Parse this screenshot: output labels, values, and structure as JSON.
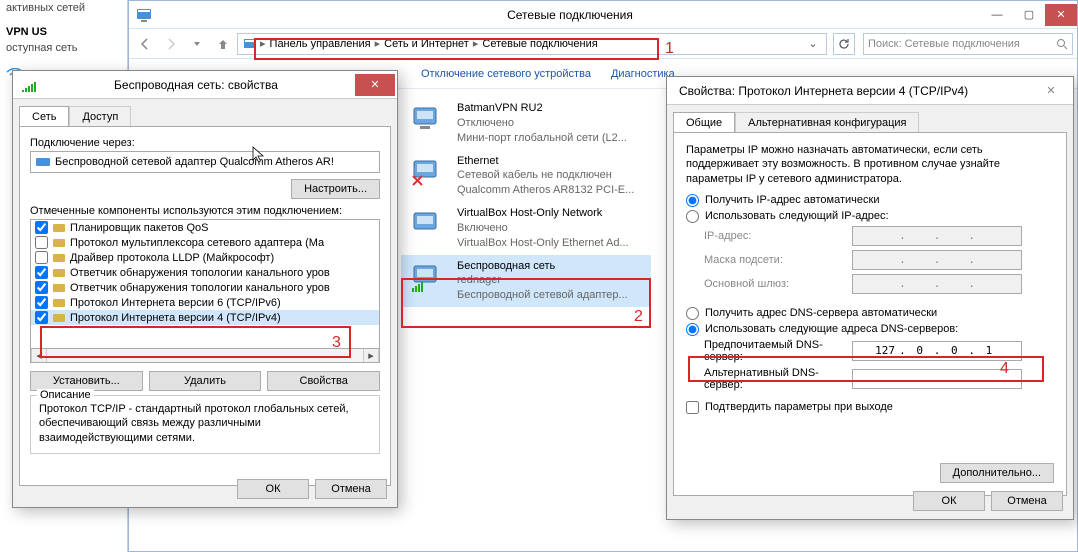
{
  "leftpanel": {
    "row1": "активных сетей",
    "vpn": "VPN US",
    "sub": "оступная сеть"
  },
  "explorer": {
    "title": "Сетевые подключения",
    "breadcrumbs": [
      "Панель управления",
      "Сеть и Интернет",
      "Сетевые подключения"
    ],
    "search_placeholder": "Поиск: Сетевые подключения",
    "toolbar": {
      "disable": "Отключение сетевого устройства",
      "diag": "Диагностика"
    },
    "items": [
      {
        "name": "BatmanVPN RU2",
        "status": "Отключено",
        "desc": "Мини-порт глобальной сети (L2..."
      },
      {
        "name": "Ethernet",
        "status": "Сетевой кабель не подключен",
        "desc": "Qualcomm Atheros AR8132 PCI-E..."
      },
      {
        "name": "VirtualBox Host-Only Network",
        "status": "Включено",
        "desc": "VirtualBox Host-Only Ethernet Ad..."
      },
      {
        "name": "Беспроводная сеть",
        "status": "rednager",
        "desc": "Беспроводной сетевой адаптер..."
      }
    ]
  },
  "dlg1": {
    "title": "Беспроводная сеть: свойства",
    "tabs": {
      "net": "Сеть",
      "access": "Доступ"
    },
    "connect_via_label": "Подключение через:",
    "adapter": "Беспроводной сетевой адаптер Qualcomm Atheros AR!",
    "configure": "Настроить...",
    "components_label": "Отмеченные компоненты используются этим подключением:",
    "components": [
      {
        "checked": true,
        "label": "Планировщик пакетов QoS"
      },
      {
        "checked": false,
        "label": "Протокол мультиплексора сетевого адаптера (Ма"
      },
      {
        "checked": false,
        "label": "Драйвер протокола LLDP (Майкрософт)"
      },
      {
        "checked": true,
        "label": "Ответчик обнаружения топологии канального уров"
      },
      {
        "checked": true,
        "label": "Ответчик обнаружения топологии канального уров"
      },
      {
        "checked": true,
        "label": "Протокол Интернета версии 6 (TCP/IPv6)"
      },
      {
        "checked": true,
        "label": "Протокол Интернета версии 4 (TCP/IPv4)"
      }
    ],
    "install": "Установить...",
    "remove": "Удалить",
    "props": "Свойства",
    "desc_title": "Описание",
    "desc": "Протокол TCP/IP - стандартный протокол глобальных сетей, обеспечивающий связь между различными взаимодействующими сетями.",
    "ok": "ОК",
    "cancel": "Отмена"
  },
  "dlg2": {
    "title": "Свойства: Протокол Интернета версии 4 (TCP/IPv4)",
    "tabs": {
      "general": "Общие",
      "alt": "Альтернативная конфигурация"
    },
    "intro": "Параметры IP можно назначать автоматически, если сеть поддерживает эту возможность. В противном случае узнайте параметры IP у сетевого администратора.",
    "ip_auto": "Получить IP-адрес автоматически",
    "ip_manual": "Использовать следующий IP-адрес:",
    "ip_label": "IP-адрес:",
    "mask_label": "Маска подсети:",
    "gw_label": "Основной шлюз:",
    "dns_auto": "Получить адрес DNS-сервера автоматически",
    "dns_manual": "Использовать следующие адреса DNS-серверов:",
    "pref_dns_label": "Предпочитаемый DNS-сервер:",
    "alt_dns_label": "Альтернативный DNS-сервер:",
    "pref_dns": [
      "127",
      "0",
      "0",
      "1"
    ],
    "confirm_exit": "Подтвердить параметры при выходе",
    "advanced": "Дополнительно...",
    "ok": "ОК",
    "cancel": "Отмена"
  },
  "annotations": {
    "1": "1",
    "2": "2",
    "3": "3",
    "4": "4"
  }
}
